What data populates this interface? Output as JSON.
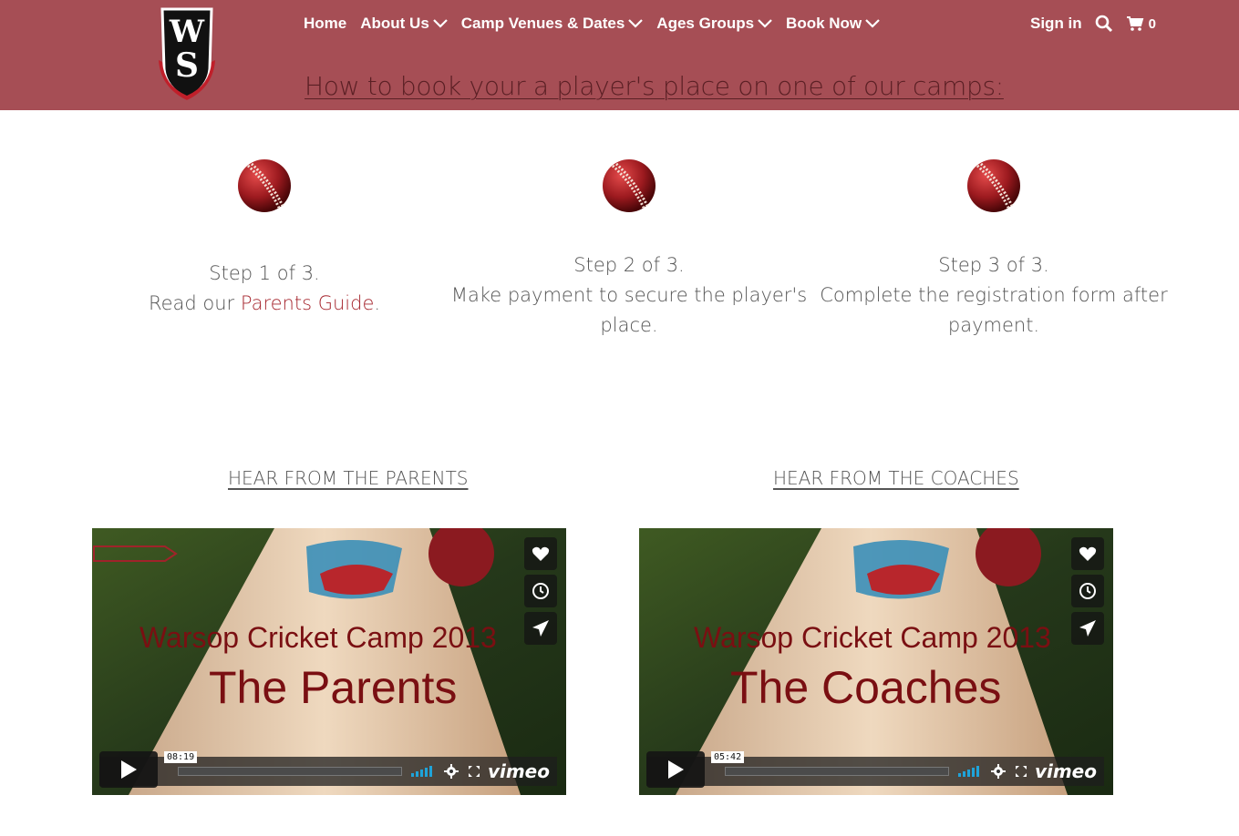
{
  "nav": {
    "items": [
      {
        "label": "Home",
        "has_dropdown": false
      },
      {
        "label": "About Us",
        "has_dropdown": true
      },
      {
        "label": "Camp Venues & Dates",
        "has_dropdown": true
      },
      {
        "label": "Ages Groups",
        "has_dropdown": true
      },
      {
        "label": "Book Now",
        "has_dropdown": true
      }
    ],
    "sign_in": "Sign in",
    "cart_count": "0"
  },
  "header": {
    "booking_link": "How to book your a player's place on one of our camps:"
  },
  "steps": [
    {
      "title": "Step 1 of 3.",
      "prefix": "Read our ",
      "link": "Parents Guide",
      "suffix": "."
    },
    {
      "title": "Step 2 of 3.",
      "text": "Make payment to secure the player's place."
    },
    {
      "title": "Step 3 of 3.",
      "text": "Complete the registration form after payment."
    }
  ],
  "videos": [
    {
      "section_title": "HEAR FROM THE PARENTS",
      "line1": "Warsop Cricket Camp 2013",
      "line2": "The Parents",
      "time": "08:19",
      "brand": "vimeo"
    },
    {
      "section_title": "HEAR FROM THE COACHES",
      "line1": "Warsop Cricket Camp 2013",
      "line2": "The Coaches",
      "time": "05:42",
      "brand": "vimeo"
    }
  ],
  "colors": {
    "header": "#a64e55",
    "link": "#a6262e",
    "text": "#555555"
  }
}
